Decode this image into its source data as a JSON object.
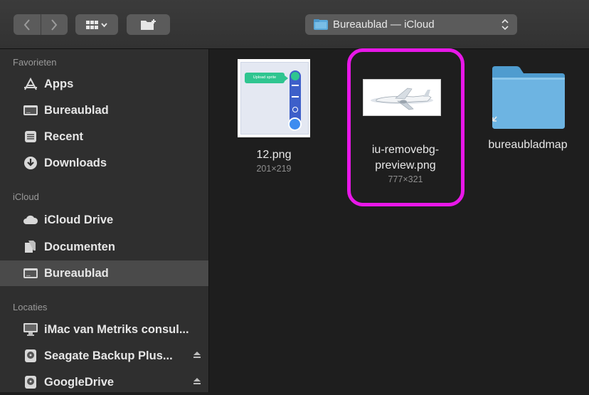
{
  "toolbar": {
    "path_title": "Bureaublad — iCloud"
  },
  "sidebar": {
    "sections": [
      {
        "title": "Favorieten",
        "items": [
          {
            "label": "Apps",
            "icon": "apps-icon"
          },
          {
            "label": "Bureaublad",
            "icon": "desktop-icon"
          },
          {
            "label": "Recent",
            "icon": "recent-icon"
          },
          {
            "label": "Downloads",
            "icon": "downloads-icon"
          }
        ]
      },
      {
        "title": "iCloud",
        "items": [
          {
            "label": "iCloud Drive",
            "icon": "cloud-icon"
          },
          {
            "label": "Documenten",
            "icon": "documents-icon"
          },
          {
            "label": "Bureaublad",
            "icon": "desktop-icon",
            "selected": true
          }
        ]
      },
      {
        "title": "Locaties",
        "items": [
          {
            "label": "iMac van Metriks consul...",
            "icon": "imac-icon"
          },
          {
            "label": "Seagate Backup Plus...",
            "icon": "drive-icon",
            "eject": true
          },
          {
            "label": "GoogleDrive",
            "icon": "drive-icon",
            "eject": true
          }
        ]
      }
    ]
  },
  "files": [
    {
      "name": "12.png",
      "dims": "201×219",
      "thumb_text": "Upload sprite"
    },
    {
      "name_line1": "iu-removebg-",
      "name_line2": "preview.png",
      "dims": "777×321",
      "highlighted": true
    },
    {
      "name": "bureaubladmap"
    }
  ],
  "colors": {
    "highlight": "#e817e8",
    "folder_blue": "#5aa9dc",
    "selected_row": "#4a4a4a"
  }
}
